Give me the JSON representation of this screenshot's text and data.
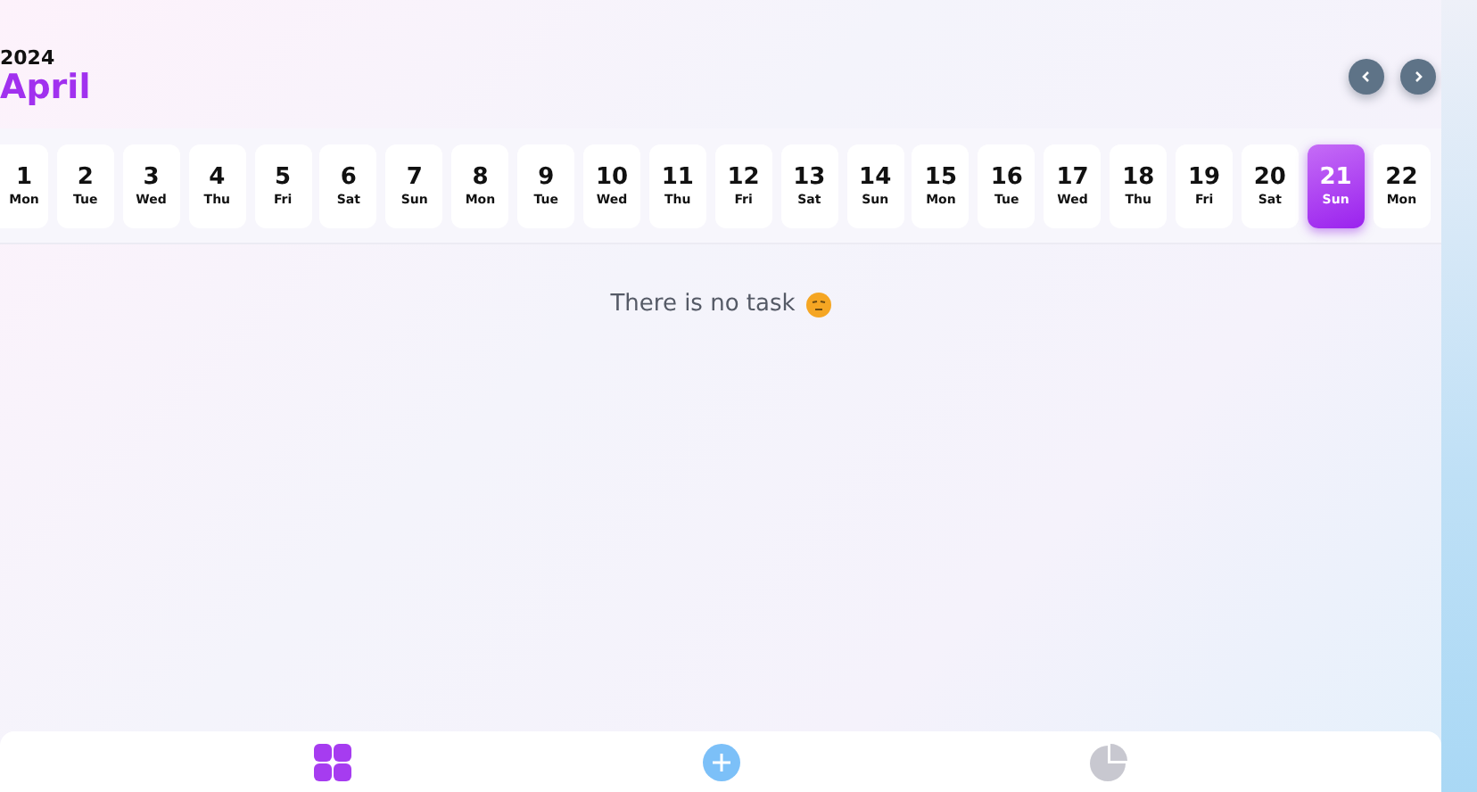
{
  "header": {
    "year": "2024",
    "month": "April"
  },
  "days": [
    {
      "date": "1",
      "weekday": "Mon",
      "selected": false
    },
    {
      "date": "2",
      "weekday": "Tue",
      "selected": false
    },
    {
      "date": "3",
      "weekday": "Wed",
      "selected": false
    },
    {
      "date": "4",
      "weekday": "Thu",
      "selected": false
    },
    {
      "date": "5",
      "weekday": "Fri",
      "selected": false
    },
    {
      "date": "6",
      "weekday": "Sat",
      "selected": false
    },
    {
      "date": "7",
      "weekday": "Sun",
      "selected": false
    },
    {
      "date": "8",
      "weekday": "Mon",
      "selected": false
    },
    {
      "date": "9",
      "weekday": "Tue",
      "selected": false
    },
    {
      "date": "10",
      "weekday": "Wed",
      "selected": false
    },
    {
      "date": "11",
      "weekday": "Thu",
      "selected": false
    },
    {
      "date": "12",
      "weekday": "Fri",
      "selected": false
    },
    {
      "date": "13",
      "weekday": "Sat",
      "selected": false
    },
    {
      "date": "14",
      "weekday": "Sun",
      "selected": false
    },
    {
      "date": "15",
      "weekday": "Mon",
      "selected": false
    },
    {
      "date": "16",
      "weekday": "Tue",
      "selected": false
    },
    {
      "date": "17",
      "weekday": "Wed",
      "selected": false
    },
    {
      "date": "18",
      "weekday": "Thu",
      "selected": false
    },
    {
      "date": "19",
      "weekday": "Fri",
      "selected": false
    },
    {
      "date": "20",
      "weekday": "Sat",
      "selected": false
    },
    {
      "date": "21",
      "weekday": "Sun",
      "selected": true
    },
    {
      "date": "22",
      "weekday": "Mon",
      "selected": false
    }
  ],
  "empty_message": "There is no task",
  "bottom_nav": [
    {
      "kind": "grid",
      "selected": true
    },
    {
      "kind": "add",
      "selected": false
    },
    {
      "kind": "chart",
      "selected": false
    }
  ]
}
